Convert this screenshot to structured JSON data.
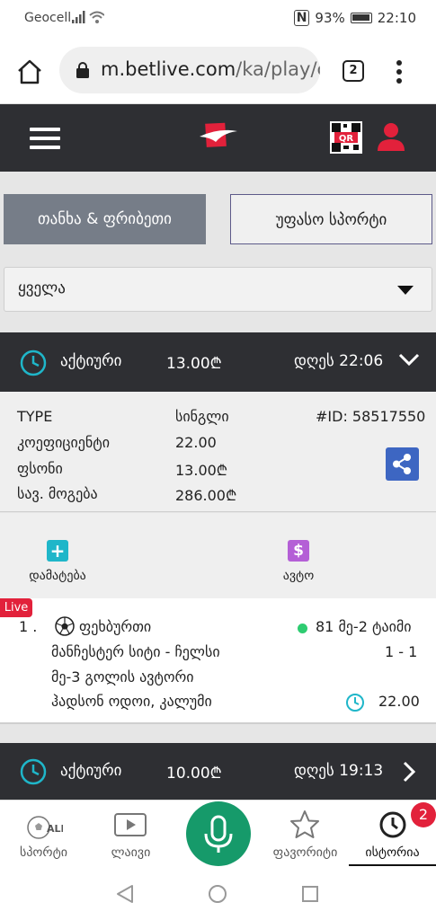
{
  "status_bar": {
    "carrier": "Geocell",
    "battery": "93%",
    "time": "22:10"
  },
  "browser": {
    "url_host": "m.betlive.com",
    "url_path": "/ka/play/c",
    "tab_count": "2"
  },
  "header": {
    "qr_label": "QR"
  },
  "tabs": {
    "active": "თანხა & ფრიბეთი",
    "inactive": "უფასო სპორტი"
  },
  "filter": {
    "selected": "ყველა"
  },
  "bet1": {
    "status": "აქტიური",
    "amount": "13.00₾",
    "date": "დღეს 22:06",
    "type_label": "TYPE",
    "type_value": "სინგლი",
    "id": "#ID: 58517550",
    "coef_label": "კოეფიციენტი",
    "coef_value": "22.00",
    "stake_label": "ფსონი",
    "stake_value": "13.00₾",
    "win_label": "სავ. მოგება",
    "win_value": "286.00₾"
  },
  "actions": {
    "add": "დამატება",
    "auto": "ავტო"
  },
  "event": {
    "live": "Live",
    "index": "1 .",
    "sport": "ფეხბურთი",
    "time_status": "81 მე-2 ტაიმი",
    "match": "მანჩესტერ სიტი - ჩელსი",
    "score": "1 - 1",
    "market": "მე-3 გოლის ავტორი",
    "selection": "ჰადსონ ოდოი, კალუმი",
    "odds": "22.00"
  },
  "bet2": {
    "status": "აქტიური",
    "amount": "10.00₾",
    "date": "დღეს 19:13"
  },
  "bottom_nav": {
    "sports": "სპორტი",
    "live": "ლაივი",
    "favorites": "ფავორიტი",
    "history": "ისტორია",
    "history_badge": "2",
    "sports_icon_text": "ALL"
  },
  "colors": {
    "dark": "#2e2f33",
    "accent_red": "#e2213b",
    "teal": "#1fb6c9",
    "green": "#169a6a",
    "share_blue": "#3d66c2"
  }
}
